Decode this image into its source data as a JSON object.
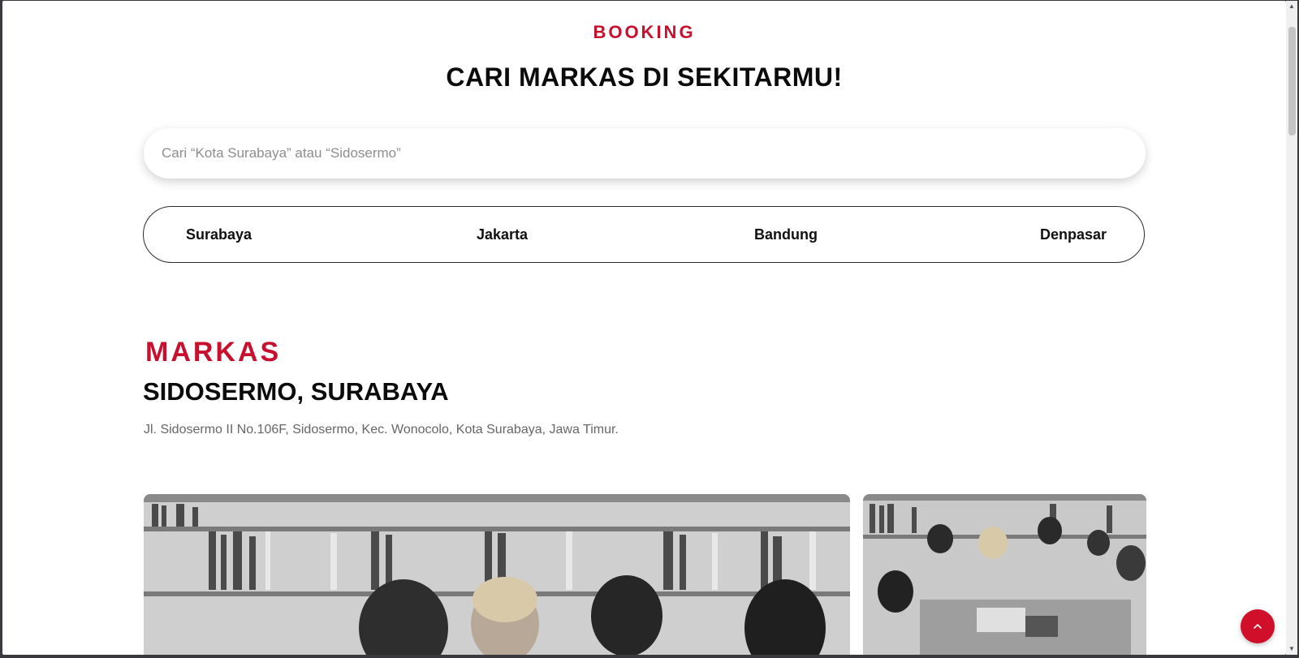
{
  "header": {
    "eyebrow": "BOOKING",
    "title": "CARI MARKAS DI SEKITARMU!"
  },
  "search": {
    "placeholder": "Cari “Kota Surabaya” atau “Sidosermo”",
    "value": ""
  },
  "cities": [
    {
      "label": "Surabaya"
    },
    {
      "label": "Jakarta"
    },
    {
      "label": "Bandung"
    },
    {
      "label": "Denpasar"
    }
  ],
  "location": {
    "eyebrow": "MARKAS",
    "title": "SIDOSERMO, SURABAYA",
    "address": "Jl. Sidosermo II No.106F, Sidosermo, Kec. Wonocolo, Kota Surabaya, Jawa Timur."
  },
  "photos": [
    {
      "icon": "photo-students-library",
      "style": "grayscale"
    },
    {
      "icon": "photo-students-group",
      "style": "grayscale"
    }
  ],
  "colors": {
    "accent": "#c8102e",
    "text": "#0b0b0b",
    "muted": "#666666"
  },
  "back_to_top": {
    "icon": "chevron-up-icon"
  }
}
